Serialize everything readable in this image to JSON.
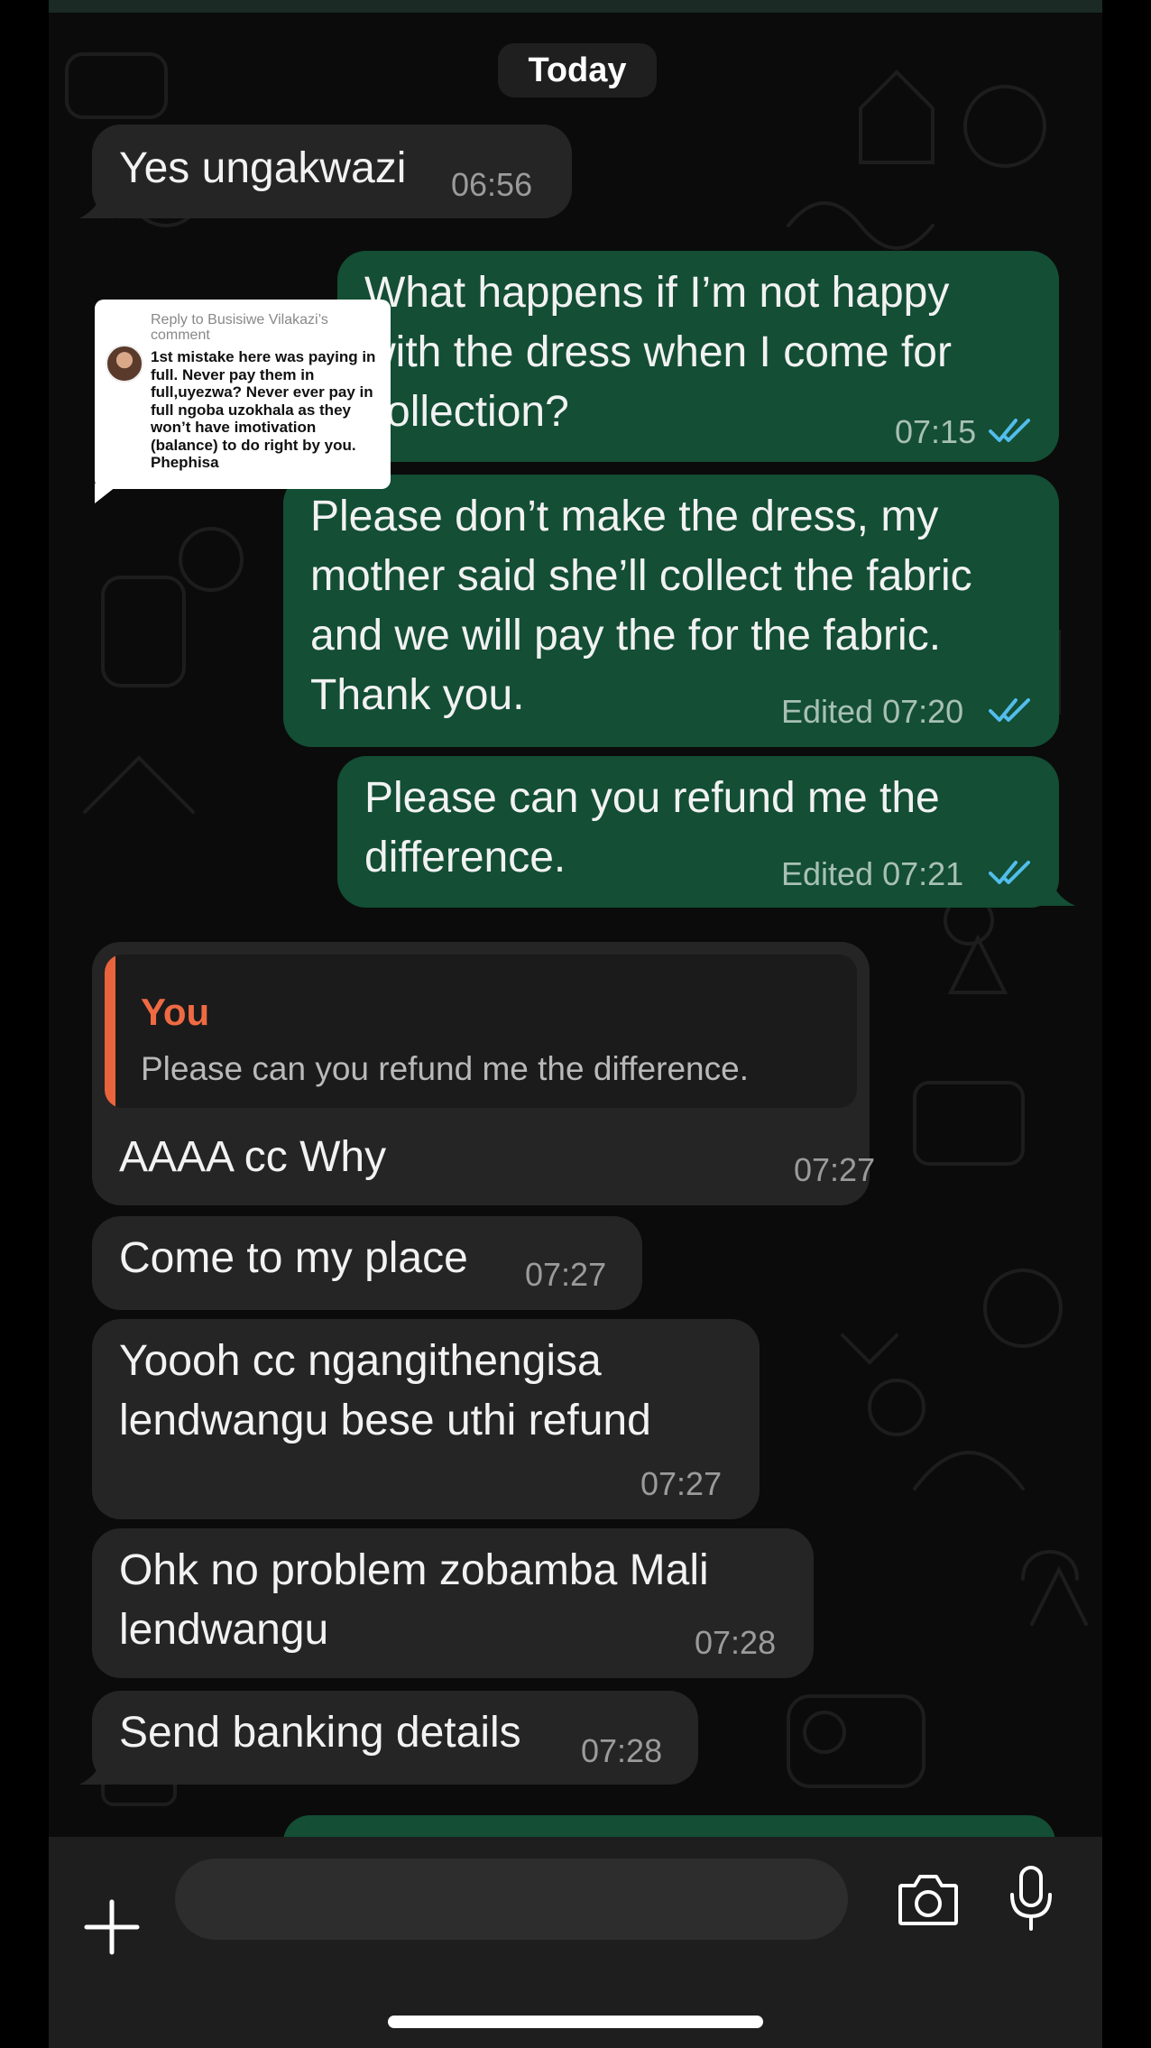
{
  "date_separator": "Today",
  "messages": [
    {
      "direction": "in",
      "text": "Yes ungakwazi",
      "time": "06:56"
    },
    {
      "direction": "out",
      "text": "What happens if I’m not happy with the dress when I come for collection?",
      "time": "07:15",
      "status": "read"
    },
    {
      "direction": "out",
      "text": "Please don’t make the dress, my mother said she’ll collect the fabric and we will pay the for the fabric. Thank you.",
      "time": "Edited 07:20",
      "status": "read"
    },
    {
      "direction": "out",
      "text": "Please can you refund me the difference.",
      "time": "Edited 07:21",
      "status": "read"
    },
    {
      "direction": "in",
      "reply_to": {
        "author": "You",
        "text": "Please can you refund me the difference."
      },
      "text": "AAAA cc Why",
      "time": "07:27"
    },
    {
      "direction": "in",
      "text": "Come to my place",
      "time": "07:27"
    },
    {
      "direction": "in",
      "text": "Yoooh cc ngangithengisa lendwangu bese uthi refund",
      "time": "07:27"
    },
    {
      "direction": "in",
      "text": "Ohk no problem zobamba Mali lendwangu",
      "time": "07:28"
    },
    {
      "direction": "in",
      "text": "Send banking details",
      "time": "07:28"
    }
  ],
  "tiktok_overlay": {
    "header": "Reply to Busisiwe Vilakazi’s comment",
    "comment": "1st mistake here was paying in full. Never pay them in full,uyezwa? Never ever pay in full ngoba uzokhala as they won’t have imotivation (balance) to do right by you. Phephisa"
  },
  "composer": {
    "value": "",
    "placeholder": ""
  },
  "icons": {
    "add": "plus-icon",
    "sticker": "sticker-icon",
    "camera": "camera-icon",
    "voice": "microphone-icon",
    "read_receipt": "double-check-icon"
  },
  "colors": {
    "incoming_bubble": "#252525",
    "outgoing_bubble": "#134e35",
    "read_tick": "#53bdeb",
    "reply_accent": "#e9633d"
  }
}
